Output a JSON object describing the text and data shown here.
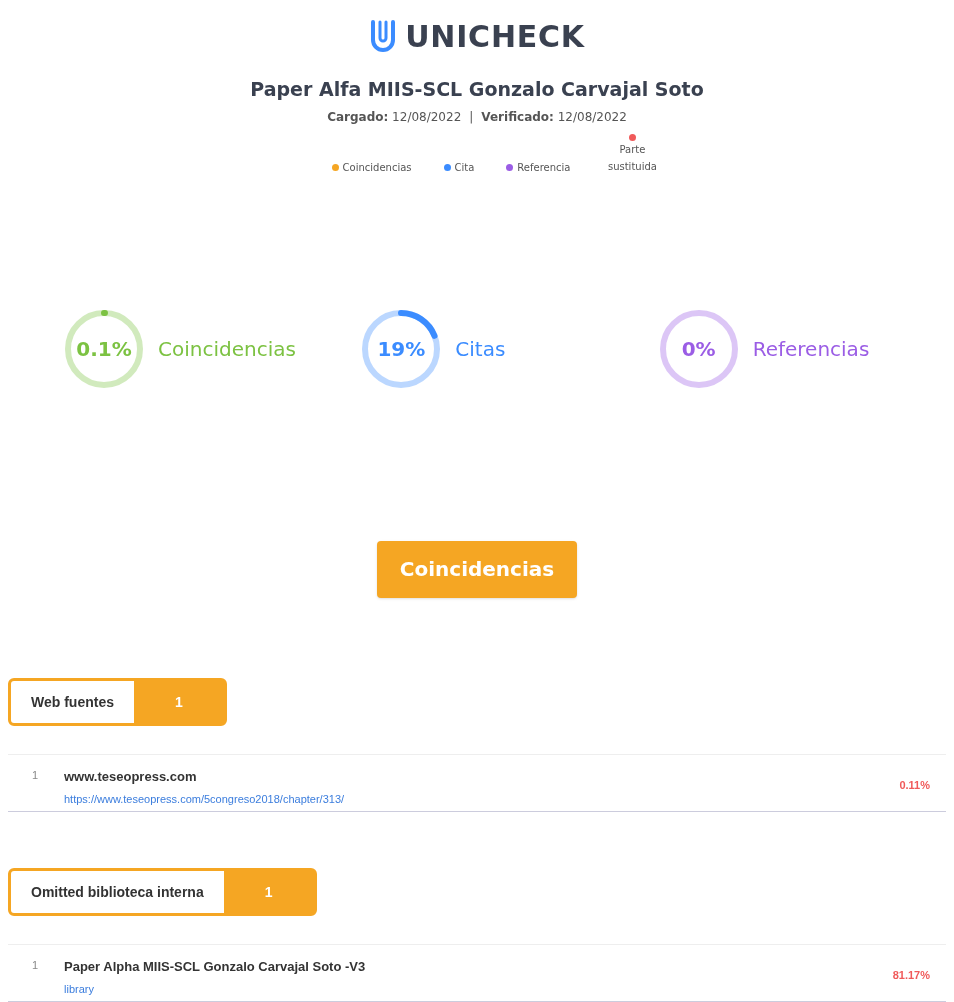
{
  "logo": {
    "text": "UNICHECK"
  },
  "report": {
    "title": "Paper Alfa MIIS-SCL Gonzalo Carvajal Soto",
    "uploaded_label": "Cargado:",
    "uploaded": "12/08/2022",
    "separator": "|",
    "verified_label": "Verificado:",
    "verified": "12/08/2022"
  },
  "legend": [
    {
      "label": "Coincidencias",
      "color": "#f5a623"
    },
    {
      "label": "Cita",
      "color": "#3b8cff"
    },
    {
      "label": "Referencia",
      "color": "#9b5de5"
    },
    {
      "label": "Parte sustituida",
      "color": "#f05a5a"
    }
  ],
  "stats": [
    {
      "value": "0.1%",
      "label": "Coincidencias",
      "level": 0.001,
      "color": "#7cc242"
    },
    {
      "value": "19%",
      "label": "Citas",
      "level": 0.19,
      "color": "#3b8cff"
    },
    {
      "value": "0%",
      "label": "Referencias",
      "level": 0,
      "color": "#9b5de5"
    }
  ],
  "section_button": "Coincidencias",
  "groups": [
    {
      "title": "Web fuentes",
      "count": "1",
      "items": [
        {
          "index": "1",
          "name": "www.teseopress.com",
          "link": "https://www.teseopress.com/5congreso2018/chapter/313/",
          "percent": "0.11%"
        }
      ]
    },
    {
      "title": "Omitted biblioteca interna",
      "count": "1",
      "items": [
        {
          "index": "1",
          "name": "Paper Alpha MIIS-SCL Gonzalo Carvajal Soto -V3",
          "link": "library",
          "percent": "81.17%"
        }
      ]
    }
  ]
}
